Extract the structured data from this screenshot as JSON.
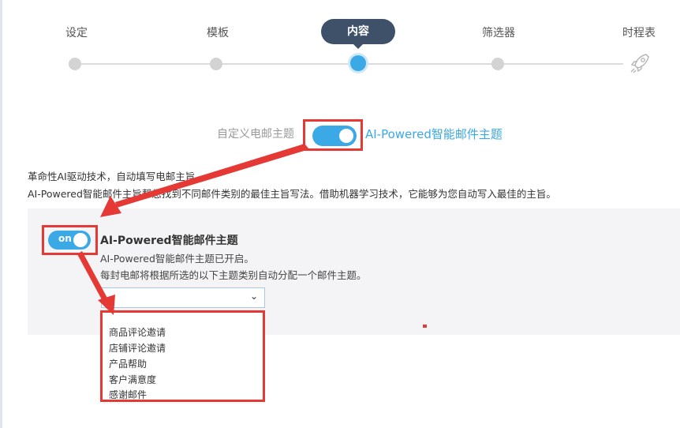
{
  "stepper": {
    "steps": [
      "设定",
      "模板",
      "内容",
      "筛选器",
      "时程表"
    ],
    "active_index": 2
  },
  "toggle_row": {
    "left_label": "自定义电邮主题",
    "right_label": "AI-Powered智能邮件主题",
    "enabled": true
  },
  "description": {
    "line1": "革命性AI驱动技术，自动填写电邮主旨。",
    "line2": "AI-Powered智能邮件主旨帮您找到不同邮件类别的最佳主旨写法。借助机器学习技术，它能够为您自动写入最佳的主旨。"
  },
  "panel": {
    "toggle_text": "on",
    "title": "AI-Powered智能邮件主题",
    "subtitle1": "AI-Powered智能邮件主题已开启。",
    "subtitle2": "每封电邮将根据所选的以下主题类别自动分配一个邮件主题。",
    "select_value": "",
    "options": [
      "商品评论邀请",
      "店铺评论邀请",
      "产品帮助",
      "客户满意度",
      "感谢邮件"
    ]
  },
  "colors": {
    "accent": "#3aa9e6",
    "annotation": "#e53935",
    "active_step_pill": "#3f5169",
    "panel_bg": "#f4f4f6"
  }
}
